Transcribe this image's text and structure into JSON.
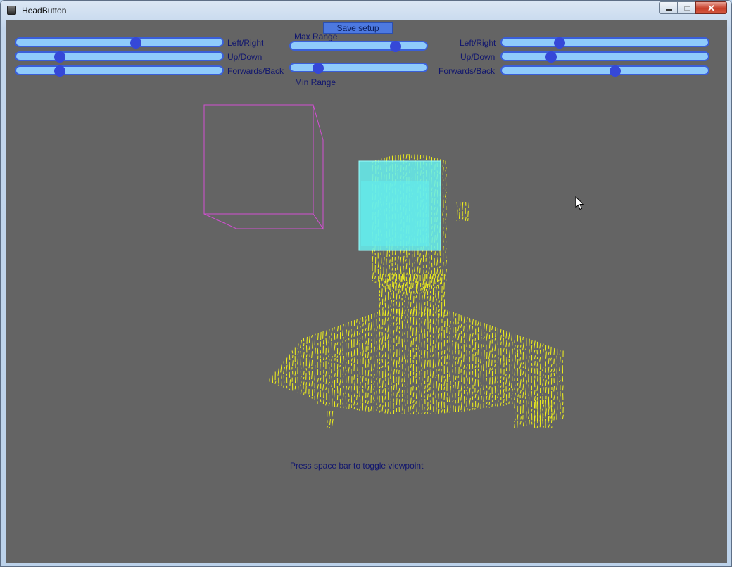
{
  "window": {
    "title": "HeadButton"
  },
  "toolbar": {
    "save_label": "Save setup"
  },
  "left_sliders": [
    {
      "label": "Left/Right",
      "value": 0.58
    },
    {
      "label": "Up/Down",
      "value": 0.21
    },
    {
      "label": "Forwards/Back",
      "value": 0.21
    }
  ],
  "range_sliders": {
    "max": {
      "label": "Max Range",
      "value": 0.77
    },
    "min": {
      "label": "Min Range",
      "value": 0.2
    }
  },
  "right_sliders": [
    {
      "label": "Left/Right",
      "value": 0.28
    },
    {
      "label": "Up/Down",
      "value": 0.24
    },
    {
      "label": "Forwards/Back",
      "value": 0.55
    }
  ],
  "viewport": {
    "hint": "Press space bar to toggle viewpoint",
    "point_cloud_color": "#f2f21a",
    "wire_box_color": "#d24fd2",
    "active_box_color": "#66f0f0"
  }
}
